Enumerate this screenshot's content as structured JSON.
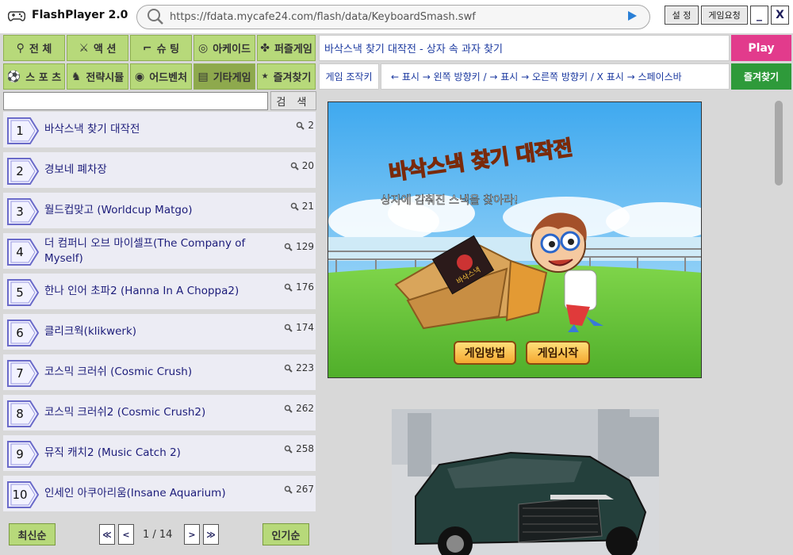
{
  "app": {
    "title": "FlashPlayer 2.0"
  },
  "urlbar": {
    "url": "https://fdata.mycafe24.com/flash/data/KeyboardSmash.swf"
  },
  "toolbar": {
    "settings_label": "설 정",
    "request_label": "게임요청",
    "minimize_label": "_",
    "close_label": "X"
  },
  "categories": [
    {
      "label": "전 체",
      "icon": "search-icon"
    },
    {
      "label": "액 션",
      "icon": "swords-icon"
    },
    {
      "label": "슈 팅",
      "icon": "gun-icon"
    },
    {
      "label": "아케이드",
      "icon": "gamepad-icon"
    },
    {
      "label": "퍼즐게임",
      "icon": "puzzle-icon"
    },
    {
      "label": "스 포 츠",
      "icon": "soccer-ball-icon"
    },
    {
      "label": "전략시뮬",
      "icon": "chess-icon"
    },
    {
      "label": "어드벤처",
      "icon": "globe-icon"
    },
    {
      "label": "기타게임",
      "icon": "chart-icon",
      "active": true
    },
    {
      "label": "즐겨찾기",
      "icon": "star-icon"
    }
  ],
  "search": {
    "button_label": "검 색",
    "value": ""
  },
  "games": [
    {
      "num": "1",
      "name": "바삭스낵 찾기 대작전",
      "views": "2"
    },
    {
      "num": "2",
      "name": "경보네 폐차장",
      "views": "20"
    },
    {
      "num": "3",
      "name": "월드컵맞고 (Worldcup Matgo)",
      "views": "21"
    },
    {
      "num": "4",
      "name": "더 컴퍼니 오브 마이셀프(The Company of Myself)",
      "views": "129"
    },
    {
      "num": "5",
      "name": "한나 인어 초파2 (Hanna In A Choppa2)",
      "views": "176"
    },
    {
      "num": "6",
      "name": "클리크웍(klikwerk)",
      "views": "174"
    },
    {
      "num": "7",
      "name": "코스믹 크러쉬 (Cosmic Crush)",
      "views": "223"
    },
    {
      "num": "8",
      "name": "코스믹 크러쉬2 (Cosmic Crush2)",
      "views": "262"
    },
    {
      "num": "9",
      "name": "뮤직 캐치2 (Music Catch 2)",
      "views": "258"
    },
    {
      "num": "10",
      "name": "인세인 아쿠아리움(Insane Aquarium)",
      "views": "267"
    }
  ],
  "pagination": {
    "newest_label": "최신순",
    "first_label": "≪",
    "prev_label": "<",
    "page_text": "1 / 14",
    "next_label": ">",
    "last_label": "≫",
    "popular_label": "인기순"
  },
  "player": {
    "game_title": "바삭스낵 찾기 대작전 - 상자 속 과자 찾기",
    "play_label": "Play",
    "controls_label": "게임 조작키",
    "controls_text": "← 표시 → 왼쪽 방향키 / → 표시 → 오른쪽 방향키 / X 표시 → 스페이스바",
    "favorite_label": "즐겨찾기"
  },
  "game_screen": {
    "logo_text": "바삭스낵 찾기 대작전",
    "subtitle": "상자에 감춰진 스낵을 찾아라!",
    "box_label": "바삭스낵",
    "howto_label": "게임방법",
    "start_label": "게임시작"
  },
  "colors": {
    "category_bg": "#b7d97a",
    "category_active": "#8ea94d",
    "play": "#e23b8c",
    "favorite": "#2e9a3a",
    "link": "#1c3aa0"
  }
}
